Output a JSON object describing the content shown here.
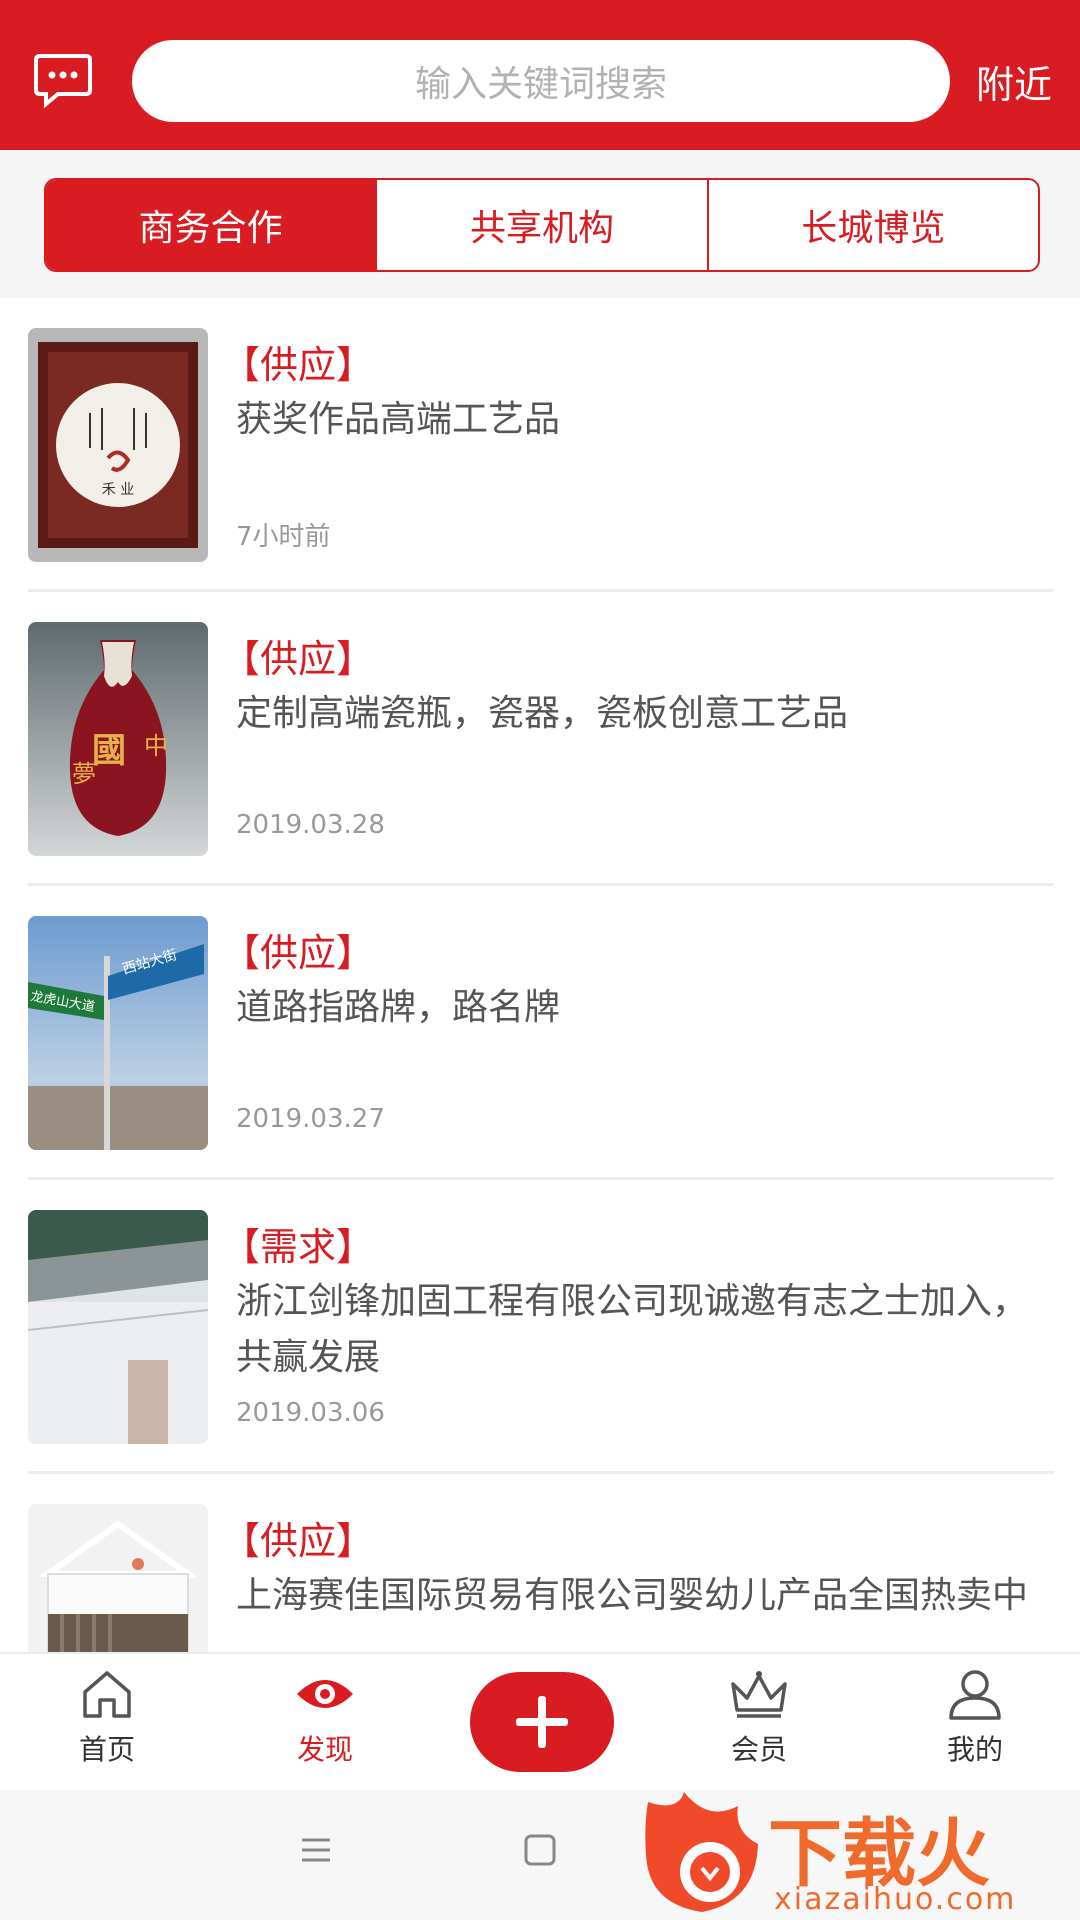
{
  "header": {
    "search_placeholder": "输入关键词搜索",
    "nearby_label": "附近"
  },
  "tabs": [
    {
      "label": "商务合作",
      "active": true
    },
    {
      "label": "共享机构",
      "active": false
    },
    {
      "label": "长城博览",
      "active": false
    }
  ],
  "items": [
    {
      "tag": "【供应】",
      "title": "获奖作品高端工艺品",
      "time": "7小时前"
    },
    {
      "tag": "【供应】",
      "title": "定制高端瓷瓶，瓷器，瓷板创意工艺品",
      "time": "2019.03.28"
    },
    {
      "tag": "【供应】",
      "title": "道路指路牌，路名牌",
      "time": "2019.03.27"
    },
    {
      "tag": "【需求】",
      "title": "浙江剑锋加固工程有限公司现诚邀有志之士加入，共赢发展",
      "time": "2019.03.06"
    },
    {
      "tag": "【供应】",
      "title": "上海赛佳国际贸易有限公司婴幼儿产品全国热卖中",
      "time": ""
    }
  ],
  "bottom_nav": {
    "home": "首页",
    "discover": "发现",
    "member": "会员",
    "mine": "我的"
  },
  "watermark": {
    "text": "下载火",
    "url": "xiazaihuo.com"
  },
  "colors": {
    "brand_red": "#d91c22",
    "text_gray": "#555555",
    "time_gray": "#999999"
  }
}
